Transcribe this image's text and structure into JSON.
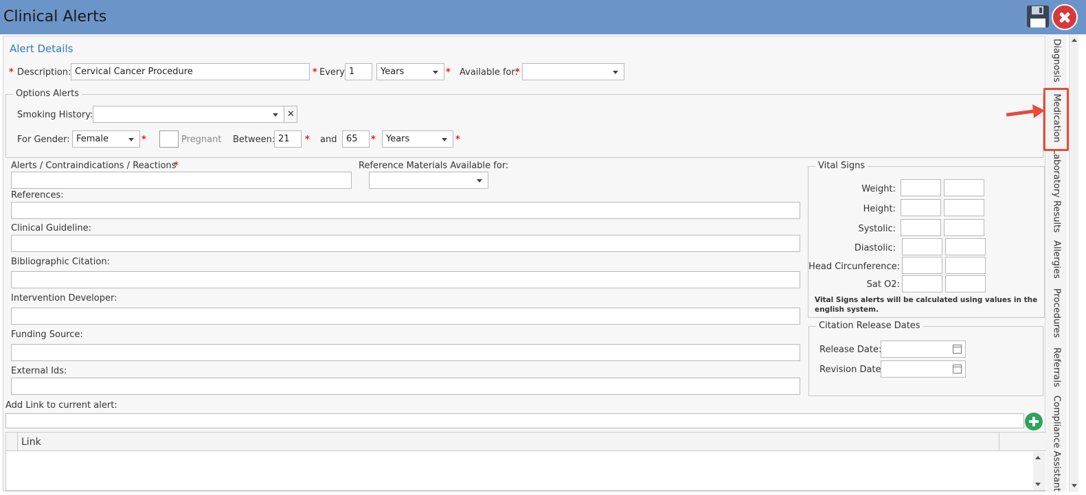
{
  "window": {
    "title": "Clinical Alerts"
  },
  "alert_details": {
    "section_title": "Alert Details",
    "description_label": "Description:",
    "description_value": "Cervical Cancer Procedure",
    "every_label": "Every:",
    "every_value": "1",
    "every_unit": "Years",
    "available_for_label": "Available for:",
    "available_for_value": ""
  },
  "options_alerts": {
    "legend": "Options Alerts",
    "smoking_history_label": "Smoking History:",
    "smoking_history_value": "",
    "clear_symbol": "✕",
    "gender_label": "For Gender:",
    "gender_value": "Female",
    "pregnant_label": "Pregnant",
    "between_label": "Between:",
    "between_from": "21",
    "and_label": "and",
    "between_to": "65",
    "age_unit": "Years"
  },
  "fields": {
    "alerts_label": "Alerts / Contraindications / Reactions",
    "reference_materials_label": "Reference Materials Available for:",
    "references_label": "References:",
    "clinical_guideline_label": "Clinical Guideline:",
    "bibliographic_label": "Bibliographic Citation:",
    "intervention_label": "Intervention Developer:",
    "funding_label": "Funding Source:",
    "external_ids_label": "External Ids:"
  },
  "vital_signs": {
    "legend": "Vital Signs",
    "rows": [
      "Weight:",
      "Height:",
      "Systolic:",
      "Diastolic:",
      "Head Circunference:",
      "Sat O2:"
    ],
    "note": "Vital Signs alerts will be calculated using values in the english system."
  },
  "citation_dates": {
    "legend": "Citation Release Dates",
    "release_label": "Release Date:",
    "revision_label": "Revision Date:"
  },
  "links": {
    "add_label": "Add Link to current alert:",
    "column_link": "Link"
  },
  "side_tabs": [
    "Diagnosis",
    "Medication",
    "Laboratory Results",
    "Allergies",
    "Procedures",
    "Referrals",
    "Compliance Assistant"
  ],
  "required_mark": "*",
  "colors": {
    "titlebar": "#6b95c9",
    "section_title": "#2b7bc4",
    "required": "#e02020",
    "highlight": "#e64b3c",
    "add_button": "#2ea35a"
  },
  "icons": {
    "save": "floppy-disk-icon",
    "close": "close-circle-icon",
    "add": "plus-circle-icon",
    "calendar": "calendar-icon"
  }
}
